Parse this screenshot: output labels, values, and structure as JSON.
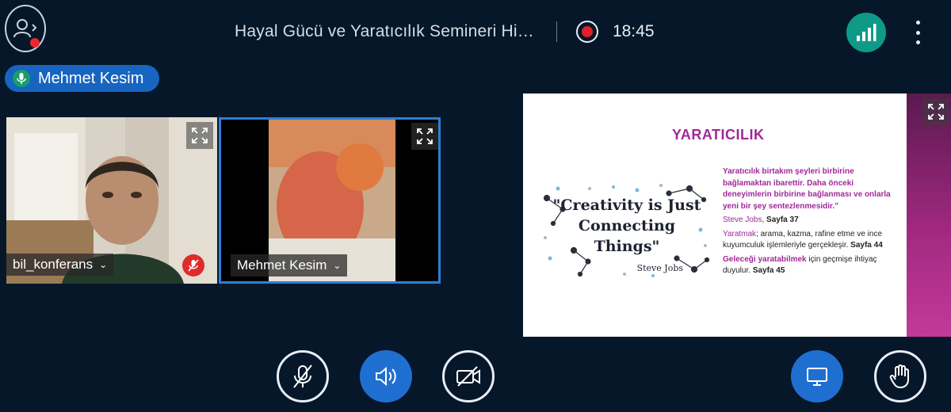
{
  "header": {
    "meeting_title": "Hayal Gücü ve Yaratıcılık Semineri Hi…",
    "recording_time": "18:45"
  },
  "talking_indicator": {
    "name": "Mehmet Kesim"
  },
  "videos": [
    {
      "username": "bil_konferans",
      "muted": true
    },
    {
      "username": "Mehmet Kesim",
      "muted": false
    }
  ],
  "presentation": {
    "title": "YARATICILIK",
    "quote": {
      "line1": "\"Creativity is Just",
      "line2": "Connecting",
      "line3": "Things\"",
      "author": "Steve Jobs"
    },
    "para1": "Yaratıcılık birtakım şeyleri birbirine bağlamaktan ibarettir. Daha önceki deneyimlerin birbirine bağlanması ve onlarla yeni bir şey sentezlenmesidir.”",
    "para1_source_name": "Steve Jobs",
    "para1_source_page": "Sayfa 37",
    "para2_term": "Yaratmak",
    "para2_text": "; arama, kazma, rafine etme ve ince kuyumculuk işlemleriyle gerçekleşir.",
    "para2_page": "Sayfa 44",
    "para3_term": "Geleceği yaratabilmek",
    "para3_text": " için geçmişe ihtiyaç duyulur.",
    "para3_page": "Sayfa 45"
  },
  "icons": {
    "users": "users-icon",
    "record": "record-icon",
    "connection": "signal-bars-icon",
    "more": "more-vertical-icon",
    "mic_off": "mic-off-icon",
    "audio": "speaker-icon",
    "video_off": "video-off-icon",
    "screen_share": "screen-share-icon",
    "raise_hand": "hand-icon",
    "fullscreen": "fullscreen-icon"
  },
  "colors": {
    "background": "#06172a",
    "accent_blue": "#1f6fd1",
    "connection_green": "#0f9a87",
    "record_red": "#e0202b",
    "slide_purple": "#a1289a"
  }
}
